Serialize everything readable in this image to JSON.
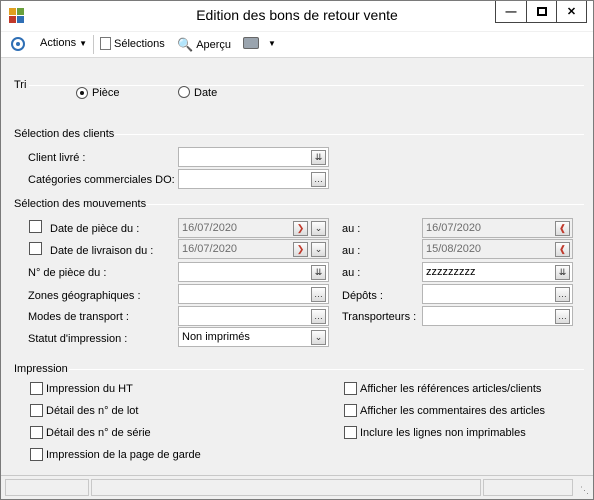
{
  "window": {
    "title": "Edition des bons de retour vente"
  },
  "toolbar": {
    "actions_label": "Actions",
    "selections_label": "Sélections",
    "apercu_label": "Aperçu"
  },
  "tri": {
    "label": "Tri",
    "options": [
      {
        "label": "Pièce",
        "selected": true
      },
      {
        "label": "Date",
        "selected": false
      }
    ]
  },
  "clients": {
    "section_label": "Sélection des clients",
    "client_livre_label": "Client livré :",
    "client_livre_value": "",
    "categories_label": "Catégories commerciales DO:",
    "categories_value": ""
  },
  "mouvements": {
    "section_label": "Sélection des mouvements",
    "date_piece_label": "Date de pièce du :",
    "date_piece_from": "16/07/2020",
    "date_piece_to": "16/07/2020",
    "date_livraison_label": "Date de livraison du :",
    "date_livraison_from": "16/07/2020",
    "date_livraison_to": "15/08/2020",
    "au_label": "au :",
    "num_piece_label": "N° de pièce du :",
    "num_piece_from": "",
    "num_piece_to": "zzzzzzzzz",
    "zones_label": "Zones géographiques :",
    "depots_label": "Dépôts :",
    "modes_label": "Modes de transport :",
    "transporteurs_label": "Transporteurs :",
    "statut_label": "Statut d'impression :",
    "statut_value": "Non imprimés"
  },
  "impression": {
    "section_label": "Impression",
    "options": [
      "Impression du HT",
      "Détail des n° de lot",
      "Détail des n° de série",
      "Impression de la page de garde",
      "Afficher les références articles/clients",
      "Afficher les commentaires des articles",
      "Inclure les lignes non imprimables"
    ]
  },
  "icons": {
    "lookup": "double-chevron-down-icon",
    "ellipsis": "ellipsis-icon",
    "calendar": "calendar-icon"
  }
}
